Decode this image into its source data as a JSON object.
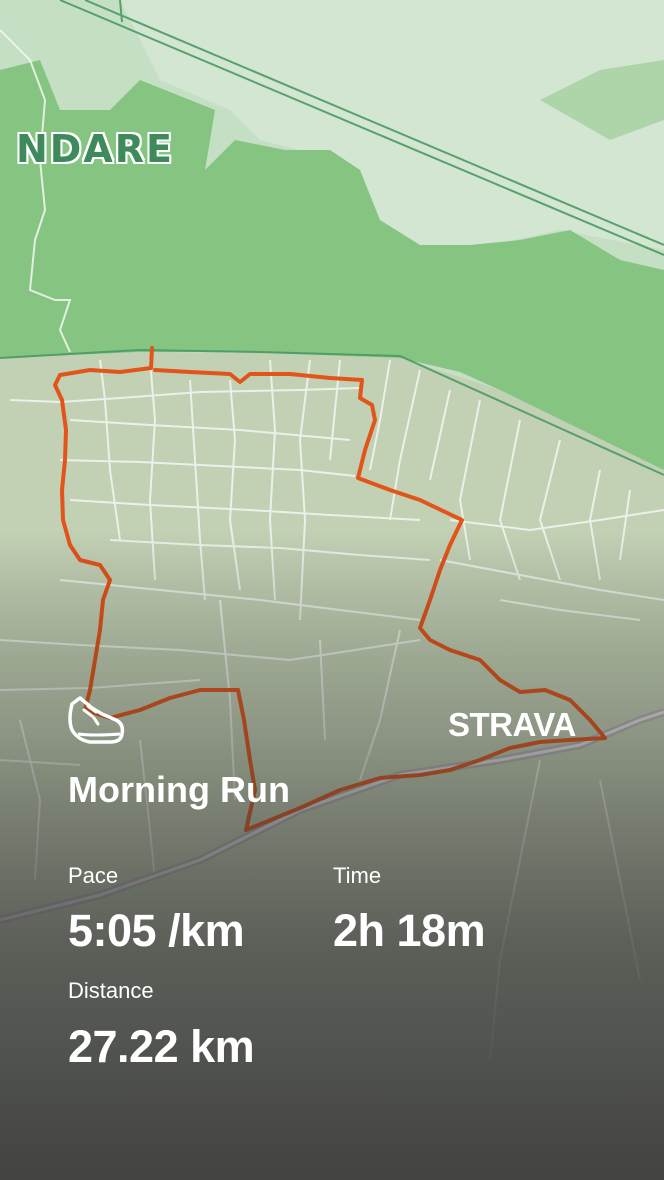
{
  "map": {
    "place_label": "NDARE",
    "route_color": "#e2541a",
    "forest_color": "#86c482",
    "road_color": "#f4f6f1"
  },
  "brand": {
    "logo_text": "STRAVA"
  },
  "activity": {
    "sport_icon": "running-shoe-icon",
    "title": "Morning Run"
  },
  "stats": {
    "pace_label": "Pace",
    "pace_value": "5:05 /km",
    "time_label": "Time",
    "time_value": "2h 18m",
    "distance_label": "Distance",
    "distance_value": "27.22 km"
  }
}
